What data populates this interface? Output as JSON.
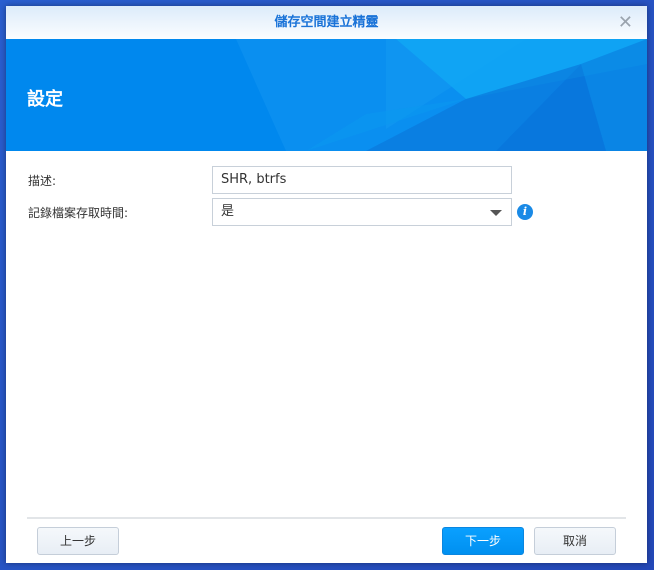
{
  "window": {
    "title": "儲存空間建立精靈",
    "close_icon": "close-icon"
  },
  "banner": {
    "heading": "設定"
  },
  "form": {
    "description": {
      "label": "描述:",
      "value": "SHR, btrfs"
    },
    "access_time": {
      "label": "記錄檔案存取時間:",
      "value": "是",
      "info_icon": "info-icon"
    }
  },
  "footer": {
    "back_label": "上一步",
    "next_label": "下一步",
    "cancel_label": "取消"
  },
  "colors": {
    "accent": "#0090f0",
    "title": "#1a73d8"
  }
}
